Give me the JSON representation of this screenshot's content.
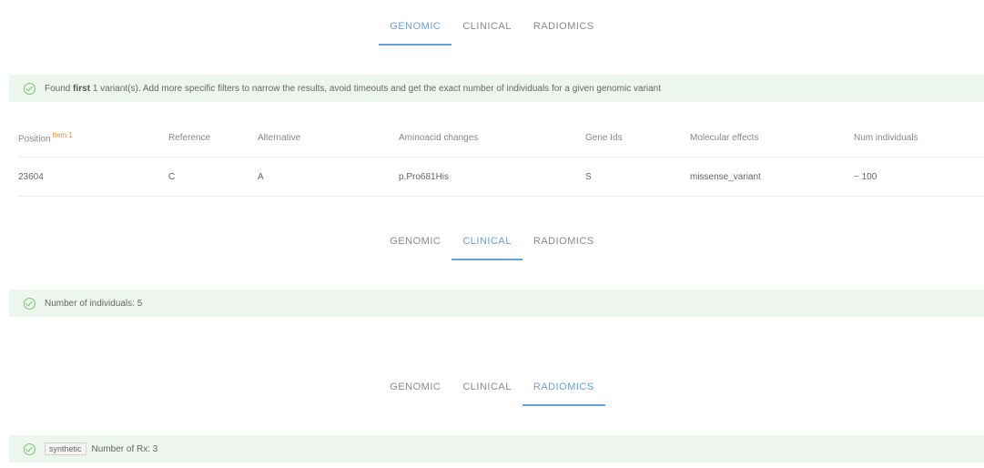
{
  "tabs": [
    "GENOMIC",
    "CLINICAL",
    "RADIOMICS"
  ],
  "genomic_banner": {
    "prefix": "Found",
    "emph": "first",
    "suffix": "1 variant(s). Add more specific filters to narrow the results, avoid timeouts and get the exact number of individuals for a given genomic variant"
  },
  "table": {
    "position_header": "Position",
    "position_hint": "Item 1",
    "headers": [
      "Reference",
      "Alternative",
      "Aminoacid changes",
      "Gene Ids",
      "Molecular effects",
      "Num individuals"
    ],
    "row": [
      "23604",
      "C",
      "A",
      "p.Pro681His",
      "S",
      "missense_variant",
      "~ 100"
    ]
  },
  "clinical_banner": {
    "text": "Number of individuals: 5"
  },
  "radiomics_banner": {
    "tag": "synthetic",
    "text": "Number of Rx: 3"
  },
  "colors": {
    "accent": "#6aa0d8",
    "success_bg": "#edf6ec",
    "success_icon": "#7fc27a",
    "hint": "#e8902c"
  }
}
